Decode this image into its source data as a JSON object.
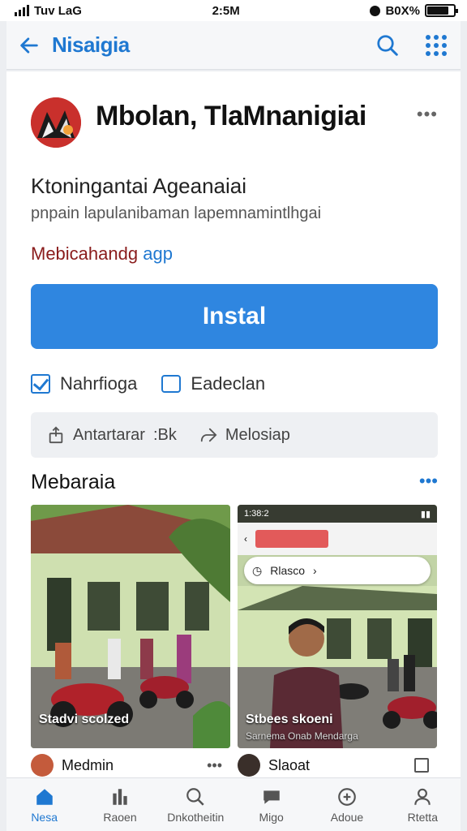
{
  "status_bar": {
    "carrier": "Tuv LaG",
    "time": "2:5M",
    "battery": "B0X%"
  },
  "app_bar": {
    "title": "Nisaigia",
    "back_icon": "arrow-left-icon",
    "search_icon": "search-icon",
    "apps_icon": "grid-icon",
    "accent": "#1f78d1"
  },
  "app": {
    "name": "Mbolan, TlaMnanigiai",
    "subtitle": "Ktoningantai Ageanaiai",
    "description": "pnpain lapulanibaman lapemnamintlhgai",
    "developer_part1": "Mebicahandg",
    "developer_part2": "agp",
    "install_label": "Instal"
  },
  "options": {
    "opt1": "Nahrfioga",
    "opt2": "Eadeclan"
  },
  "actions": {
    "share_label": "Antartarar",
    "share_extra": ":Bk",
    "send_label": "Melosiap"
  },
  "media": {
    "section_title": "Mebaraia",
    "items": [
      {
        "caption": "Stadvi scolzed",
        "footer": "Medmin"
      },
      {
        "caption": "Stbees skoeni",
        "caption_sub": "Sarnema Onab Mendarga",
        "footer": "Slaoat",
        "phone_time": "1:38:2",
        "pill_text": "Rlasco"
      }
    ]
  },
  "bottom_nav": [
    {
      "label": "Nesa",
      "icon": "home-icon"
    },
    {
      "label": "Raoen",
      "icon": "apps-icon"
    },
    {
      "label": "Dnkotheitin",
      "icon": "search-icon"
    },
    {
      "label": "Migo",
      "icon": "chat-icon"
    },
    {
      "label": "Adoue",
      "icon": "add-circle-icon"
    },
    {
      "label": "Rtetta",
      "icon": "person-icon"
    }
  ]
}
